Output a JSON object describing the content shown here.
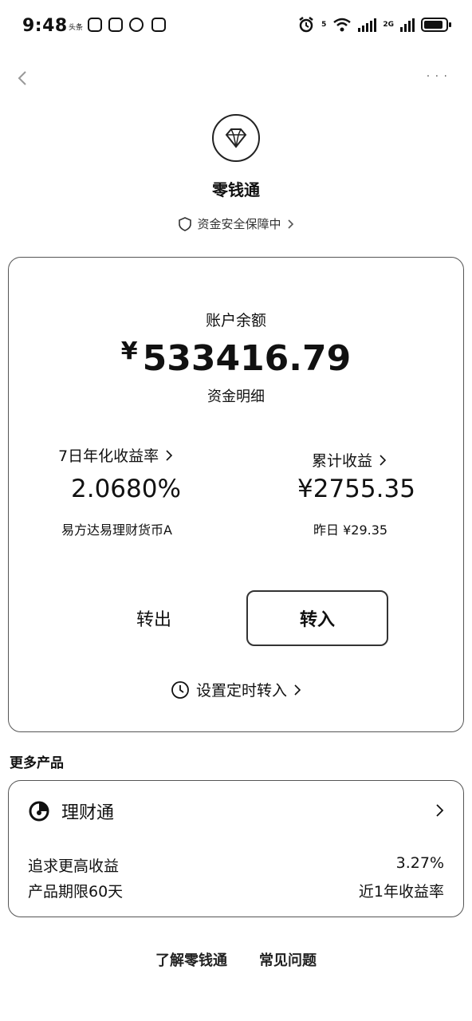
{
  "status_bar": {
    "time": "9:48",
    "mini_label": "头条",
    "network_tag": "2G",
    "signal_tag": "5"
  },
  "header": {
    "app_title": "零钱通",
    "safety_text": "资金安全保障中"
  },
  "account": {
    "balance_label": "账户余额",
    "currency_symbol": "¥",
    "balance": "533416.79",
    "details_link": "资金明细",
    "yield_label": "7日年化收益率",
    "yield_value": "2.0680%",
    "fund_name": "易方达易理财货币A",
    "cumulative_label": "累计收益",
    "cumulative_value": "¥2755.35",
    "yesterday_text": "昨日 ¥29.35",
    "transfer_out": "转出",
    "transfer_in": "转入",
    "schedule_text": "设置定时转入"
  },
  "more_products": {
    "title": "更多产品",
    "product_name": "理财通",
    "row1_left": "追求更高收益",
    "row1_right": "3.27%",
    "row2_left": "产品期限60天",
    "row2_right": "近1年收益率"
  },
  "footer": {
    "learn_link": "了解零钱通",
    "faq_link": "常见问题"
  },
  "icons": {
    "logo": "diamond-icon",
    "back": "back-arrow-icon",
    "shield": "shield-icon",
    "clock": "clock-icon",
    "product": "licaitong-icon",
    "chevron": "chevron-right-icon"
  }
}
